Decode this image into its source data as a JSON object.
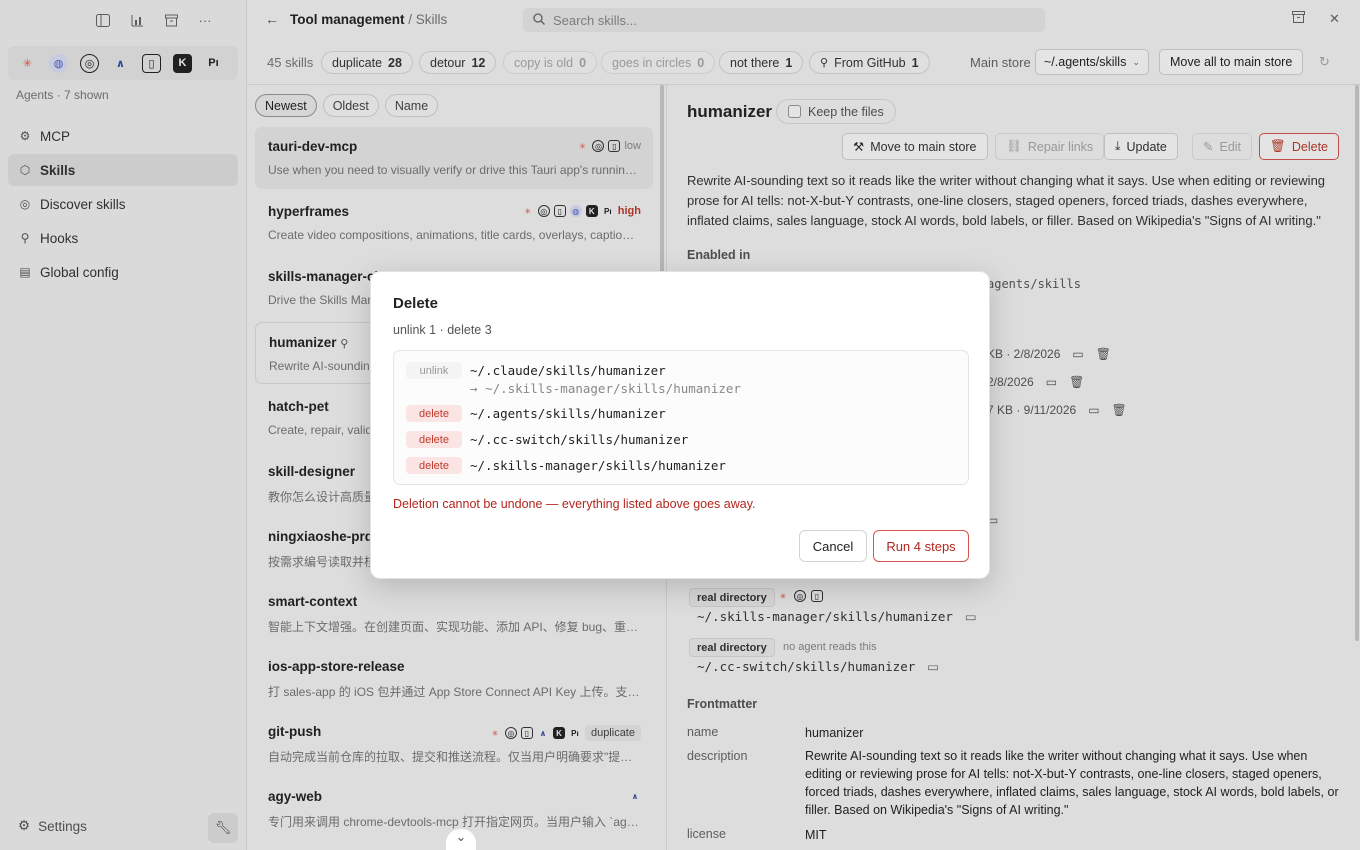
{
  "sidebar": {
    "agents_caption": "Agents · 7 shown",
    "items": [
      {
        "label": "MCP",
        "icon": "mcp-icon"
      },
      {
        "label": "Skills",
        "icon": "skills-cube-icon"
      },
      {
        "label": "Discover skills",
        "icon": "compass-icon"
      },
      {
        "label": "Hooks",
        "icon": "hook-icon"
      },
      {
        "label": "Global config",
        "icon": "document-icon"
      }
    ],
    "settings_label": "Settings"
  },
  "header": {
    "breadcrumb_root": "Tool management",
    "breadcrumb_rest": "/ Skills",
    "search_placeholder": "Search skills..."
  },
  "filterbar": {
    "count": "45 skills",
    "chips": [
      {
        "label": "duplicate",
        "count": "28"
      },
      {
        "label": "detour",
        "count": "12"
      },
      {
        "label": "copy is old",
        "count": "0"
      },
      {
        "label": "goes in circles",
        "count": "0"
      },
      {
        "label": "not there",
        "count": "1"
      },
      {
        "label": "From GitHub",
        "count": "1"
      }
    ],
    "main_store_label": "Main store",
    "main_store_value": "~/.agents/skills",
    "move_all_label": "Move all to main store"
  },
  "list": {
    "sort_tabs": [
      "Newest",
      "Oldest",
      "Name"
    ],
    "items": [
      {
        "name": "tauri-dev-mcp",
        "desc": "Use when you need to visually verify or drive this Tauri app's running instance",
        "tag": "low"
      },
      {
        "name": "hyperframes",
        "desc": "Create video compositions, animations, title cards, overlays, captions and more",
        "tag": "high"
      },
      {
        "name": "skills-manager-cl",
        "desc": "Drive the Skills Manager",
        "tag": ""
      },
      {
        "name": "humanizer",
        "desc": "Rewrite AI-sounding text",
        "tag": ""
      },
      {
        "name": "hatch-pet",
        "desc": "Create, repair, validate",
        "tag": ""
      },
      {
        "name": "skill-designer",
        "desc": "教你怎么设计高质量",
        "tag": ""
      },
      {
        "name": "ningxiaoshe-prd",
        "desc": "按需求编号读取并核",
        "tag": ""
      },
      {
        "name": "smart-context",
        "desc": "智能上下文增强。在创建页面、实现功能、添加 API、修复 bug、重构代码时自动加载",
        "tag": ""
      },
      {
        "name": "ios-app-store-release",
        "desc": "打 sales-app 的 iOS 包并通过 App Store Connect API Key 上传。支持自动递增构建号",
        "tag": ""
      },
      {
        "name": "git-push",
        "desc": "自动完成当前仓库的拉取、提交和推送流程。仅当用户明确要求\"提交并推送\"时使用",
        "tag": "duplicate"
      },
      {
        "name": "agy-web",
        "desc": "专门用来调用 chrome-devtools-mcp 打开指定网页。当用户输入 `agy-web` 时触发",
        "tag": ""
      }
    ]
  },
  "detail": {
    "title": "humanizer",
    "keep_files_label": "Keep the files",
    "buttons": {
      "move": "Move to main store",
      "repair": "Repair links",
      "update": "Update",
      "edit": "Edit",
      "delete": "Delete"
    },
    "description": "Rewrite AI-sounding text so it reads like the writer without changing what it says. Use when editing or reviewing prose for AI tells: not-X-but-Y contrasts, one-line closers, staged openers, forced triads, dashes everywhere, inflated claims, sales language, stock AI words, bold labels, or filler. Based on Wikipedia's \"Signs of AI writing.\"",
    "enabled_in_label": "Enabled in",
    "frag_path": "agents/skills",
    "frag_rows": [
      "KB · 2/8/2026",
      "2/8/2026",
      "7 KB · 9/11/2026"
    ],
    "real_dir_label": "real directory",
    "no_agent_label": "no agent reads this",
    "path_skills_manager": "~/.skills-manager/skills/humanizer",
    "path_cc_switch": "~/.cc-switch/skills/humanizer",
    "frontmatter_label": "Frontmatter",
    "fm": {
      "name_key": "name",
      "name_val": "humanizer",
      "desc_key": "description",
      "desc_val": "Rewrite AI-sounding text so it reads like the writer without changing what it says. Use when editing or reviewing prose for AI tells: not-X-but-Y contrasts, one-line closers, staged openers, forced triads, dashes everywhere, inflated claims, sales language, stock AI words, bold labels, or filler. Based on Wikipedia's \"Signs of AI writing.\"",
      "license_key": "license",
      "license_val": "MIT"
    }
  },
  "modal": {
    "title": "Delete",
    "subtitle": "unlink 1 · delete 3",
    "steps": [
      {
        "action": "unlink",
        "path": "~/.claude/skills/humanizer",
        "target": "→ ~/.skills-manager/skills/humanizer"
      },
      {
        "action": "delete",
        "path": "~/.agents/skills/humanizer",
        "target": ""
      },
      {
        "action": "delete",
        "path": "~/.cc-switch/skills/humanizer",
        "target": ""
      },
      {
        "action": "delete",
        "path": "~/.skills-manager/skills/humanizer",
        "target": ""
      }
    ],
    "warning": "Deletion cannot be undone — everything listed above goes away.",
    "cancel_label": "Cancel",
    "run_label": "Run 4 steps"
  },
  "colors": {
    "danger": "#c0392b",
    "accent_claude": "#e5533d",
    "badge_high": "#c0392b"
  }
}
